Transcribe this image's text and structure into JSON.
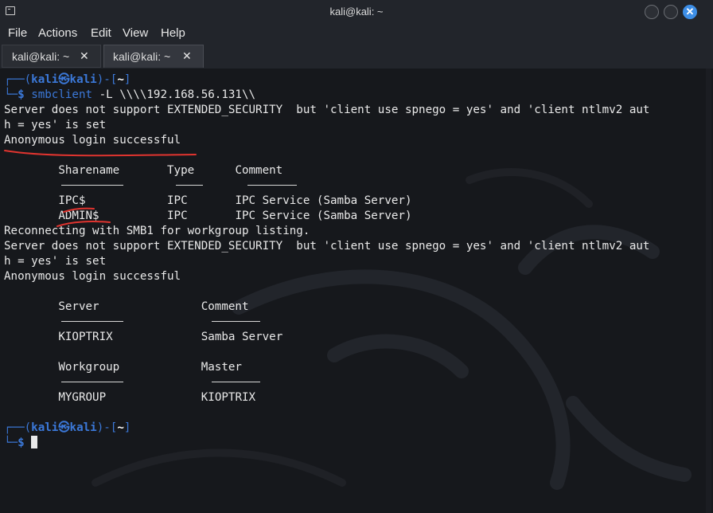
{
  "window": {
    "title": "kali@kali: ~"
  },
  "menu": [
    "File",
    "Actions",
    "Edit",
    "View",
    "Help"
  ],
  "tabs": [
    {
      "label": "kali@kali: ~",
      "close": "✕"
    },
    {
      "label": "kali@kali: ~",
      "close": "✕"
    }
  ],
  "terminal": {
    "prompt1": {
      "open": "┌──(",
      "user": "kali㉿kali",
      "mid": ")-[",
      "dir": "~",
      "close": "]"
    },
    "prompt1_line2": {
      "corner": "└─",
      "dollar": "$ ",
      "cmd": "smbclient",
      "args": " -L \\\\\\\\192.168.56.131\\\\"
    },
    "out1": "Server does not support EXTENDED_SECURITY  but 'client use spnego = yes' and 'client ntlmv2 aut",
    "out2": "h = yes' is set",
    "out3": "Anonymous login successful",
    "out4": "",
    "share_header": {
      "name": "Sharename",
      "type": "Type",
      "comment": "Comment"
    },
    "shares": [
      {
        "name": "IPC$",
        "type": "IPC",
        "comment": "IPC Service (Samba Server)"
      },
      {
        "name": "ADMIN$",
        "type": "IPC",
        "comment": "IPC Service (Samba Server)"
      }
    ],
    "out5": "Reconnecting with SMB1 for workgroup listing.",
    "out6": "Server does not support EXTENDED_SECURITY  but 'client use spnego = yes' and 'client ntlmv2 aut",
    "out7": "h = yes' is set",
    "out8": "Anonymous login successful",
    "server_header": {
      "server": "Server",
      "comment": "Comment"
    },
    "server_row": {
      "server": "KIOPTRIX",
      "comment": "Samba Server"
    },
    "workgroup_header": {
      "workgroup": "Workgroup",
      "master": "Master"
    },
    "workgroup_row": {
      "workgroup": "MYGROUP",
      "master": "KIOPTRIX"
    },
    "prompt2": {
      "open": "┌──(",
      "user": "kali㉿kali",
      "mid": ")-[",
      "dir": "~",
      "close": "]"
    },
    "prompt2_line2": {
      "corner": "└─",
      "dollar": "$ "
    }
  },
  "colors": {
    "accent": "#3b78d8",
    "annotation": "#e0342f",
    "terminal_bg": "#16181c",
    "chrome_bg": "#22252b"
  }
}
